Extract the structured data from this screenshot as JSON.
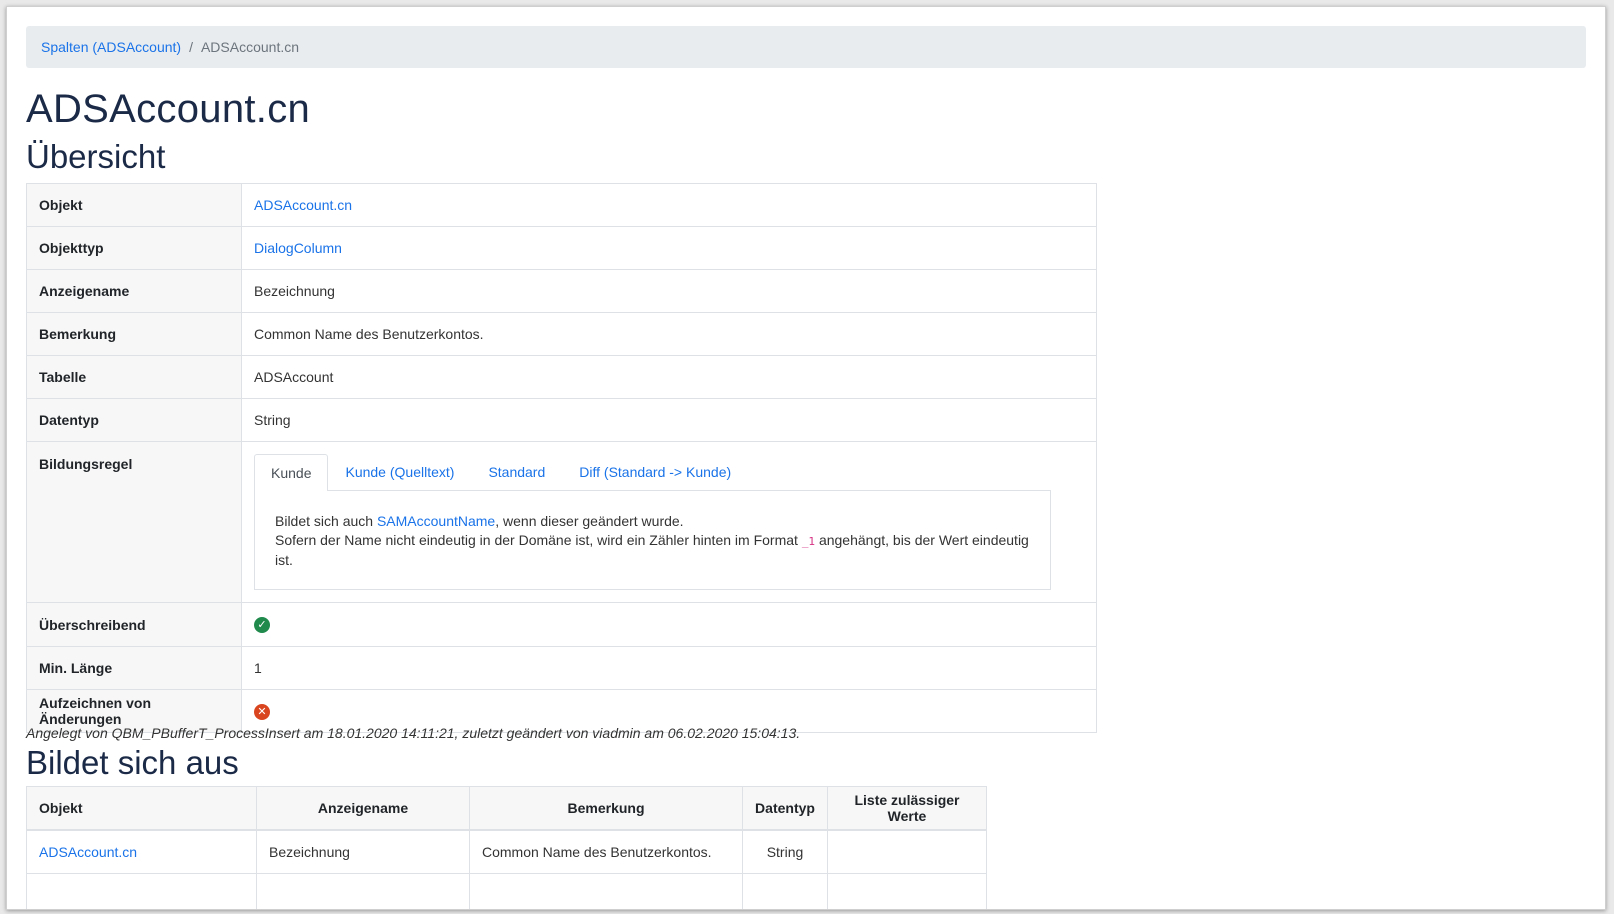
{
  "breadcrumb": {
    "parent_link": "Spalten (ADSAccount)",
    "separator": "/",
    "current": "ADSAccount.cn"
  },
  "page_title": "ADSAccount.cn",
  "overview": {
    "heading": "Übersicht",
    "rows": {
      "objekt": {
        "label": "Objekt",
        "value": "ADSAccount.cn"
      },
      "objekttyp": {
        "label": "Objekttyp",
        "value": "DialogColumn"
      },
      "anzeigename": {
        "label": "Anzeigename",
        "value": "Bezeichnung"
      },
      "bemerkung": {
        "label": "Bemerkung",
        "value": "Common Name des Benutzerkontos."
      },
      "tabelle": {
        "label": "Tabelle",
        "value": "ADSAccount"
      },
      "datentyp": {
        "label": "Datentyp",
        "value": "String"
      },
      "bildungsregel": {
        "label": "Bildungsregel",
        "tabs": [
          "Kunde",
          "Kunde (Quelltext)",
          "Standard",
          "Diff (Standard -> Kunde)"
        ],
        "active_tab": "Kunde",
        "line1_prefix": "Bildet sich auch ",
        "line1_link": "SAMAccountName",
        "line1_suffix": ", wenn dieser geändert wurde.",
        "line2_prefix": "Sofern der Name nicht eindeutig in der Domäne ist, wird ein Zähler hinten im Format ",
        "line2_code": "_1",
        "line2_suffix": " angehängt, bis der Wert eindeutig ist."
      },
      "ueberschreibend": {
        "label": "Überschreibend",
        "icon": "check-circle-icon",
        "icon_glyph": "✓",
        "color": "#1f8a4c"
      },
      "min_laenge": {
        "label": "Min. Länge",
        "value": "1"
      },
      "aufzeichnen": {
        "label": "Aufzeichnen von Änderungen",
        "icon": "x-circle-icon",
        "icon_glyph": "✕",
        "color": "#d9451f"
      }
    }
  },
  "meta_text": "Angelegt von QBM_PBufferT_ProcessInsert am 18.01.2020 14:11:21, zuletzt geändert von viadmin am 06.02.2020 15:04:13.",
  "bildet_sich_aus": {
    "heading": "Bildet sich aus",
    "columns": [
      "Objekt",
      "Anzeigename",
      "Bemerkung",
      "Datentyp",
      "Liste zulässiger Werte"
    ],
    "rows": [
      {
        "objekt": "ADSAccount.cn",
        "anzeigename": "Bezeichnung",
        "bemerkung": "Common Name des Benutzerkontos.",
        "datentyp": "String",
        "liste": ""
      }
    ]
  }
}
